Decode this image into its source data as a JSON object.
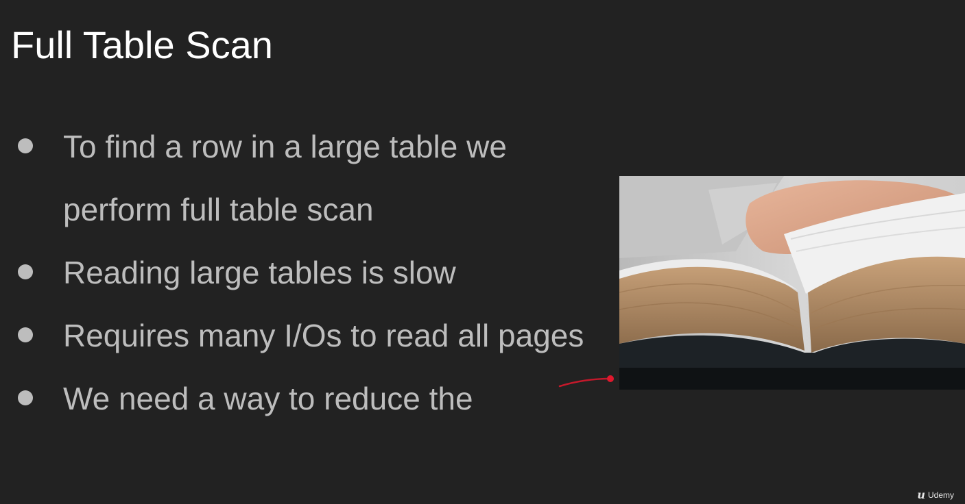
{
  "slide": {
    "title": "Full Table Scan",
    "bullets": [
      "To find a row in a large table we perform full table scan",
      "Reading large tables is slow",
      "Requires many I/Os to read all pages",
      "We need a way to reduce the"
    ]
  },
  "image": {
    "icon": "open-book-photo"
  },
  "watermark": {
    "logo_glyph": "u",
    "brand": "Udemy"
  },
  "colors": {
    "background": "#222222",
    "title": "#ffffff",
    "bullet_text": "#bdbdbd",
    "pointer": "#e0182d"
  }
}
